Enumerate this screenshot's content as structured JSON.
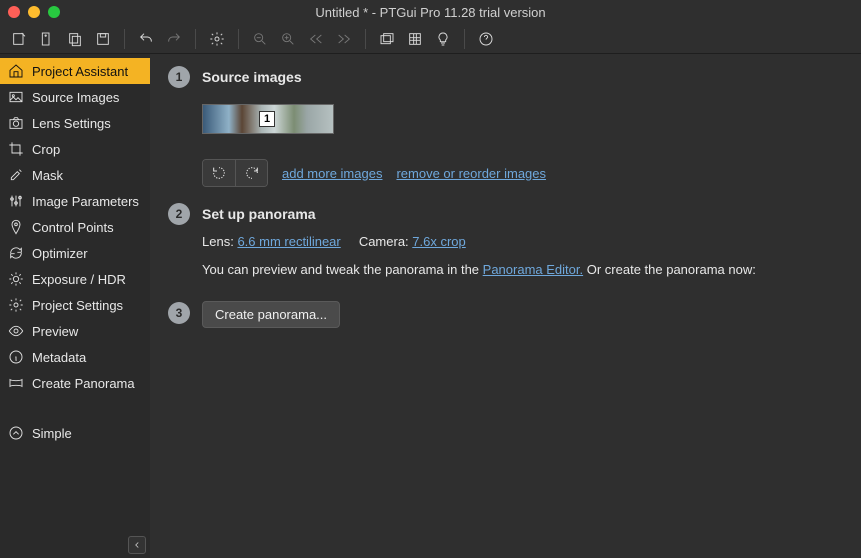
{
  "window": {
    "title": "Untitled * - PTGui Pro 11.28 trial version"
  },
  "sidebar": {
    "items": [
      {
        "label": "Project Assistant"
      },
      {
        "label": "Source Images"
      },
      {
        "label": "Lens Settings"
      },
      {
        "label": "Crop"
      },
      {
        "label": "Mask"
      },
      {
        "label": "Image Parameters"
      },
      {
        "label": "Control Points"
      },
      {
        "label": "Optimizer"
      },
      {
        "label": "Exposure / HDR"
      },
      {
        "label": "Project Settings"
      },
      {
        "label": "Preview"
      },
      {
        "label": "Metadata"
      },
      {
        "label": "Create Panorama"
      }
    ],
    "simple": "Simple"
  },
  "steps": {
    "s1": {
      "num": "1",
      "title": "Source images"
    },
    "s2": {
      "num": "2",
      "title": "Set up panorama"
    },
    "s3": {
      "num": "3"
    }
  },
  "thumb": {
    "index": "1"
  },
  "actions": {
    "add": "add more images",
    "remove": "remove or reorder images"
  },
  "setup": {
    "lensLabel": "Lens:",
    "lensValue": "6.6 mm rectilinear",
    "cameraLabel": "Camera:",
    "cameraValue": "7.6x crop",
    "previewText1": "You can preview and tweak the panorama in the ",
    "editorLink": "Panorama Editor.",
    "previewText2": " Or create the panorama now:"
  },
  "createBtn": "Create panorama..."
}
